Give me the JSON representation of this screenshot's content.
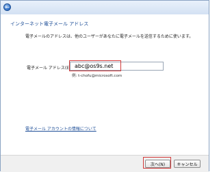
{
  "header": {
    "title": "インターネット電子メール アドレス",
    "back_icon": "back-arrow-icon"
  },
  "main": {
    "description": "電子メールのアドレスは、他のユーザーがあなたに電子メールを送信するために使います。",
    "email_label": "電子メール アドレス(E):",
    "email_value": "abc@os9s.net",
    "example": "例: t-chofu@microsoft.com",
    "info_link": "電子メール アカウントの情報について"
  },
  "footer": {
    "next_label": "次へ(N)",
    "cancel_label": "キャンセル"
  },
  "colors": {
    "highlight": "#d23a3a",
    "title_blue": "#1f4f98"
  }
}
